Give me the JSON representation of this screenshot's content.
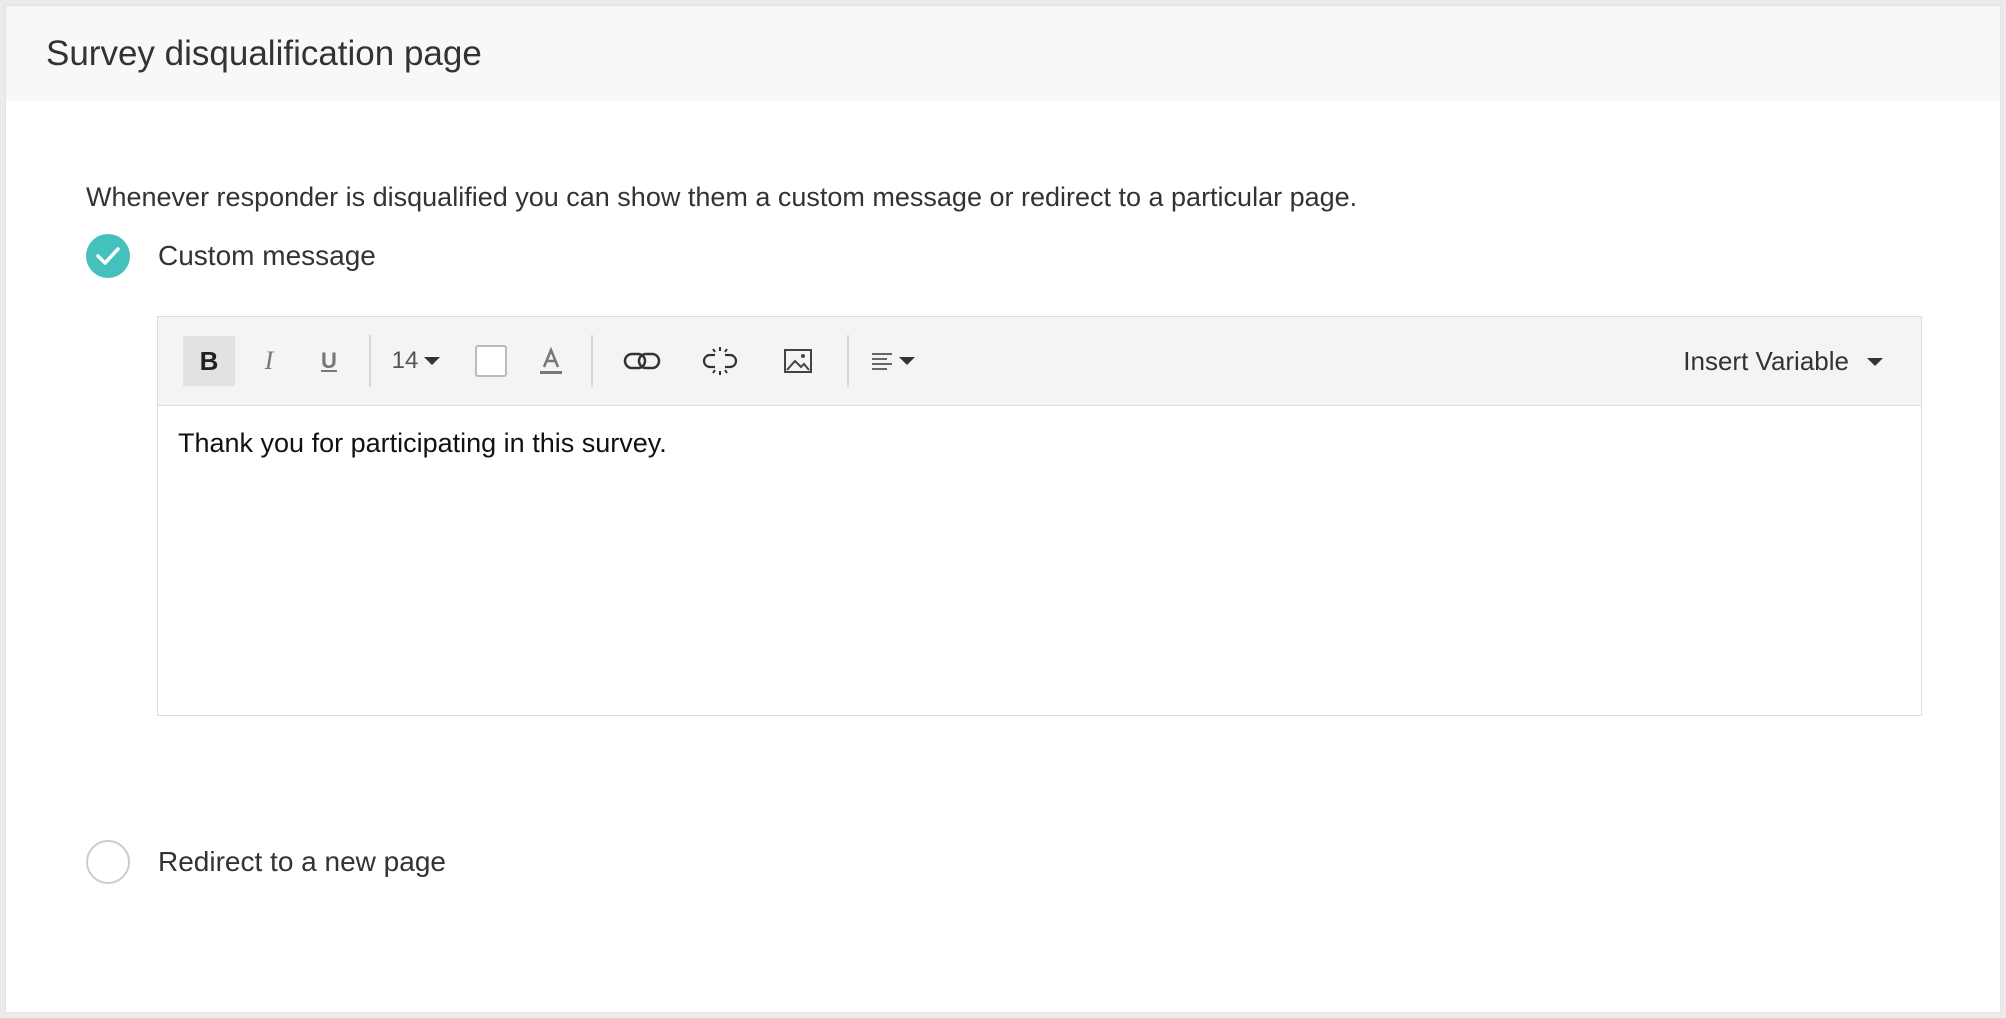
{
  "header": {
    "title": "Survey disqualification page"
  },
  "description": "Whenever responder is disqualified you can show them a custom message or redirect to a particular page.",
  "options": {
    "custom_message": {
      "label": "Custom message",
      "selected": true
    },
    "redirect": {
      "label": "Redirect to a new page",
      "selected": false
    }
  },
  "editor": {
    "toolbar": {
      "bold": "B",
      "italic": "I",
      "underline": "U",
      "font_size": "14",
      "insert_variable_label": "Insert Variable",
      "icons": [
        "bold-icon",
        "italic-icon",
        "underline-icon",
        "chevron-down-icon",
        "background-color-icon",
        "text-color-icon",
        "link-icon",
        "unlink-icon",
        "image-icon",
        "align-left-icon"
      ]
    },
    "content": "Thank you for participating in this survey."
  },
  "colors": {
    "accent": "#45c1bd",
    "header_bg": "#f8f8f8",
    "toolbar_bg": "#f4f4f4"
  }
}
